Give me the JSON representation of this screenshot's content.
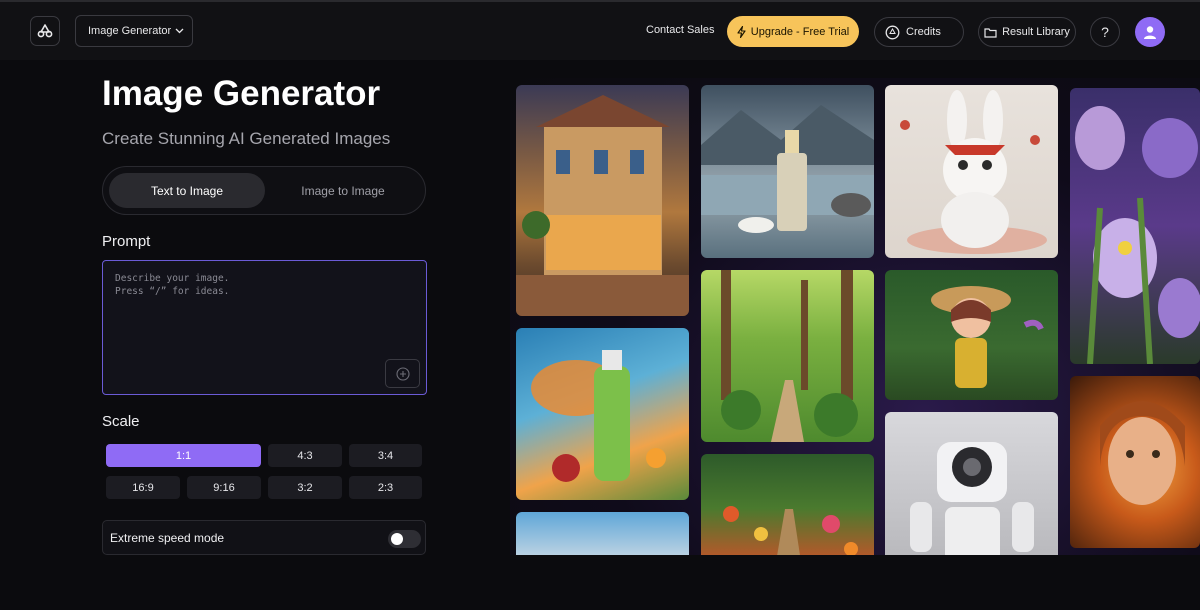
{
  "header": {
    "app_selector": "Image Generator",
    "contact_sales": "Contact Sales",
    "upgrade": "Upgrade - Free Trial",
    "credits": "Credits",
    "result_library": "Result Library",
    "help": "?"
  },
  "main": {
    "title": "Image Generator",
    "subtitle": "Create Stunning AI Generated Images",
    "tabs": [
      {
        "label": "Text to Image",
        "active": true
      },
      {
        "label": "Image to Image",
        "active": false
      }
    ],
    "prompt_label": "Prompt",
    "prompt_placeholder": "Describe your image.\nPress “/” for ideas.",
    "scale_label": "Scale",
    "scale_options": [
      "1:1",
      "4:3",
      "3:4",
      "16:9",
      "9:16",
      "3:2",
      "2:3"
    ],
    "scale_selected": "1:1",
    "speed_mode_label": "Extreme speed mode",
    "speed_mode_on": false
  },
  "gallery": {
    "images": [
      "cafe-house-image",
      "perfume-bottle-image",
      "white-rabbit-toy-image",
      "iris-flowers-image",
      "juice-bottle-image",
      "forest-path-image",
      "cartoon-girl-image",
      "fiery-portrait-image",
      "product-flowers-image",
      "flower-garden-path-image",
      "white-robot-image"
    ]
  },
  "colors": {
    "accent": "#8f6bf5",
    "upgrade": "#f7c45a",
    "background": "#0b0b0e"
  }
}
